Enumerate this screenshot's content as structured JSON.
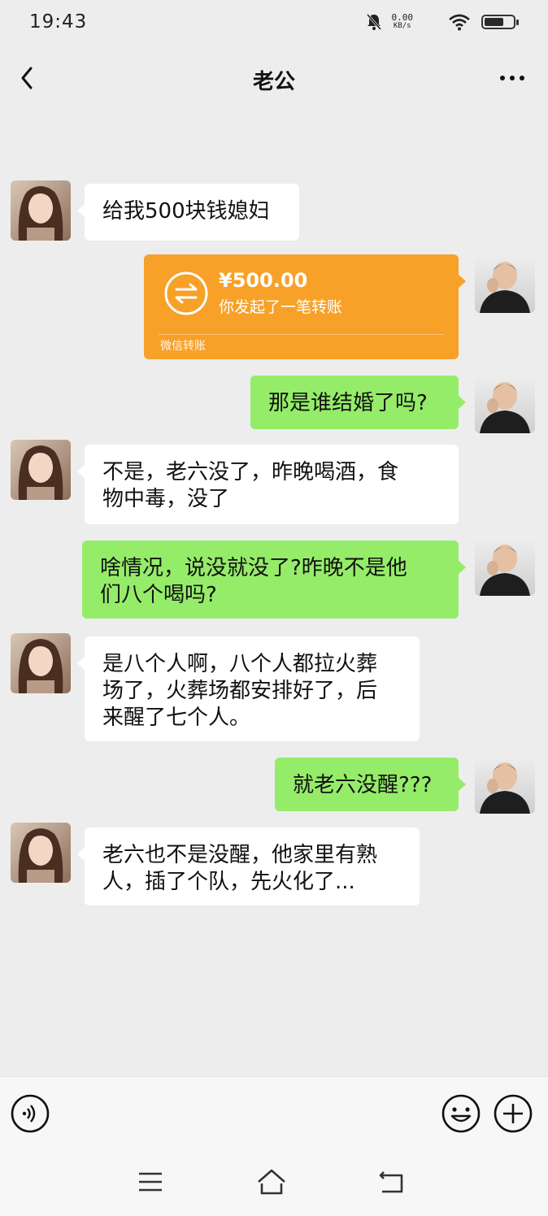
{
  "status_bar": {
    "time": "19:43",
    "net_speed_value": "0.00",
    "net_speed_unit": "KB/s"
  },
  "header": {
    "title": "老公"
  },
  "messages": [
    {
      "side": "left",
      "text": "给我500块钱媳妇"
    },
    {
      "side": "right",
      "type": "transfer",
      "amount": "¥500.00",
      "desc": "你发起了一笔转账",
      "brand": "微信转账"
    },
    {
      "side": "right",
      "text": "那是谁结婚了吗?"
    },
    {
      "side": "left",
      "line1": "不是，老六没了，昨晚喝酒，食",
      "line2": "物中毒，没了"
    },
    {
      "side": "right",
      "line1": "啥情况，说没就没了?昨晚不是他",
      "line2": "们八个喝吗?"
    },
    {
      "side": "left",
      "line1": "是八个人啊，八个人都拉火葬",
      "line2": "场了，火葬场都安排好了，后",
      "line3": "来醒了七个人。"
    },
    {
      "side": "right",
      "text": "就老六没醒???"
    },
    {
      "side": "left",
      "line1": "老六也不是没醒，他家里有熟",
      "line2": "人，插了个队，先火化了..."
    }
  ],
  "colors": {
    "bg": "#ededed",
    "bubble_green": "#95ec69",
    "bubble_white": "#ffffff",
    "transfer": "#f7a128"
  },
  "icons": [
    "back-icon",
    "more-icon",
    "voice-icon",
    "emoji-icon",
    "plus-icon",
    "transfer-icon",
    "menu-icon",
    "home-icon",
    "return-icon"
  ]
}
